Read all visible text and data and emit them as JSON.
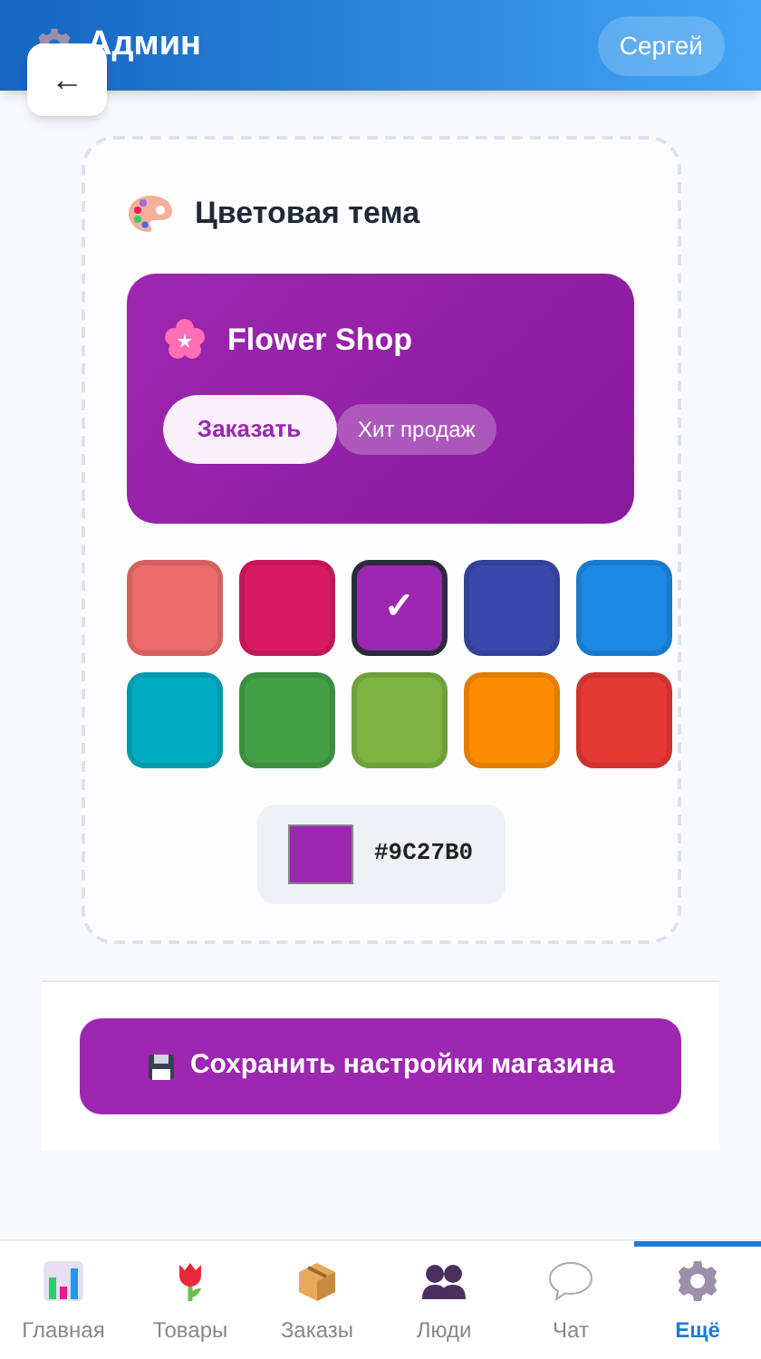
{
  "header": {
    "title": "Админ",
    "user": "Сергей",
    "back": "←"
  },
  "theme": {
    "title": "Цветовая тема",
    "preview": {
      "shop_name": "Flower Shop",
      "primary_button": "Заказать",
      "badge": "Хит продаж"
    },
    "swatches": [
      {
        "color": "#ec6b6b",
        "selected": false
      },
      {
        "color": "#d81b60",
        "selected": false
      },
      {
        "color": "#9c27b0",
        "selected": true
      },
      {
        "color": "#3949ab",
        "selected": false
      },
      {
        "color": "#1e88e5",
        "selected": false
      },
      {
        "color": "#00acc1",
        "selected": false
      },
      {
        "color": "#43a047",
        "selected": false
      },
      {
        "color": "#7cb342",
        "selected": false
      },
      {
        "color": "#fb8c00",
        "selected": false
      },
      {
        "color": "#e53935",
        "selected": false
      }
    ],
    "check": "✓",
    "current": {
      "color": "#9c27b0",
      "hex": "#9C27B0"
    }
  },
  "save_button": "Сохранить настройки магазина",
  "nav": [
    {
      "kind": "chart",
      "label": "Главная",
      "selected": false
    },
    {
      "kind": "tulip",
      "label": "Товары",
      "selected": false
    },
    {
      "kind": "box",
      "label": "Заказы",
      "selected": false
    },
    {
      "kind": "people",
      "label": "Люди",
      "selected": false
    },
    {
      "kind": "chat",
      "label": "Чат",
      "selected": false
    },
    {
      "kind": "gear",
      "label": "Ещё",
      "selected": true
    }
  ]
}
